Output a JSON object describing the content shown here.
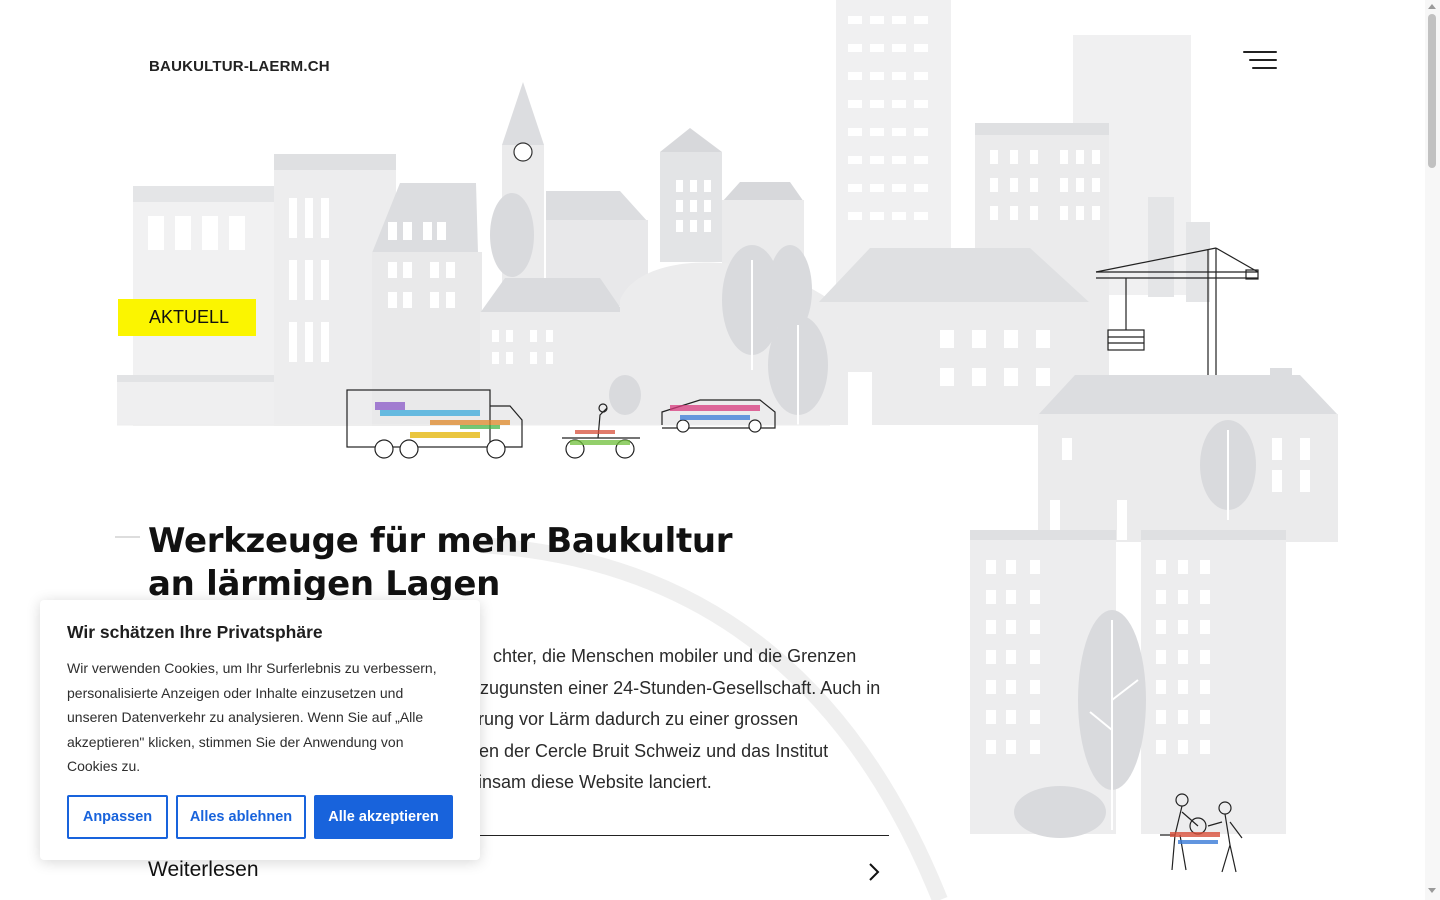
{
  "header": {
    "site_title": "BAUKULTUR-LAERM.CH",
    "menu_icon": "hamburger-icon"
  },
  "news_tag": "AKTUELL",
  "hero": {
    "title_lines": [
      "Werkzeuge für mehr Baukultur",
      "an lärmigen Lagen"
    ],
    "intro_lines": [
      "chter, die Menschen mobiler und die Grenzen",
      "zugunsten einer 24-Stunden-Gesellschaft. Auch in",
      "rung vor Lärm dadurch zu einer grossen",
      "en der Cercle Bruit Schweiz und das Institut",
      "insam diese Website lanciert."
    ],
    "read_more": "Weiterlesen",
    "read_more_icon": "chevron-right-icon"
  },
  "cookie_banner": {
    "title": "Wir schätzen Ihre Privatsphäre",
    "text_lines": [
      "Wir verwenden Cookies, um Ihr Surferlebnis zu verbessern,",
      "personalisierte Anzeigen oder Inhalte einzusetzen und",
      "unseren Datenverkehr zu analysieren. Wenn Sie auf „Alle",
      "akzeptieren\" klicken, stimmen Sie der Anwendung von",
      "Cookies zu."
    ],
    "buttons": {
      "customize": "Anpassen",
      "reject": "Alles ablehnen",
      "accept": "Alle akzeptieren"
    }
  },
  "colors": {
    "accent_yellow": "#fbf500",
    "button_blue": "#1863dc",
    "building_light": "#ebebec",
    "building_mid": "#dcdde0"
  }
}
